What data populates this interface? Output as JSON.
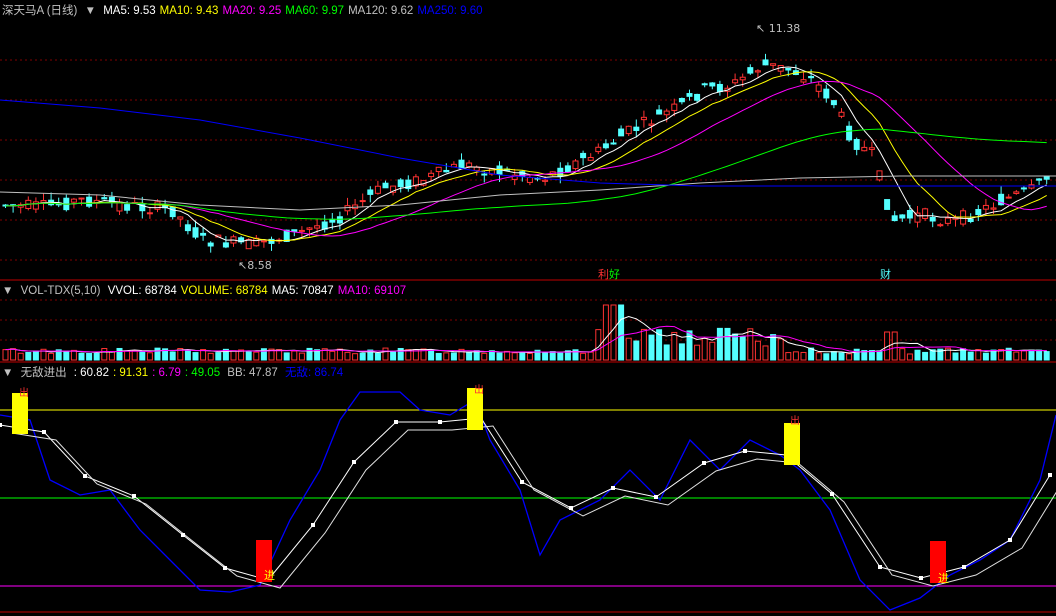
{
  "main": {
    "title": "深天马A (日线)",
    "ma": [
      {
        "label": "MA5:",
        "value": "9.53",
        "color": "#ffffff"
      },
      {
        "label": "MA10:",
        "value": "9.43",
        "color": "#ffff00"
      },
      {
        "label": "MA20:",
        "value": "9.25",
        "color": "#ff00ff"
      },
      {
        "label": "MA60:",
        "value": "9.97",
        "color": "#00ff00"
      },
      {
        "label": "MA120:",
        "value": "9.62",
        "color": "#c0c0c0"
      },
      {
        "label": "MA250:",
        "value": "9.60",
        "color": "#0000ff"
      }
    ],
    "high_label": "11.38",
    "low_label": "8.58",
    "markers": {
      "m1": "利",
      "m2": "好",
      "m3": "财"
    }
  },
  "volume": {
    "title": "VOL-TDX(5,10)",
    "items": [
      {
        "label": "VVOL: ",
        "value": "68784",
        "color": "#ffffff"
      },
      {
        "label": "VOLUME: ",
        "value": "68784",
        "color": "#ffff00"
      },
      {
        "label": "MA5: ",
        "value": "70847",
        "color": "#ffffff"
      },
      {
        "label": "MA10: ",
        "value": "69107",
        "color": "#ff00ff"
      }
    ]
  },
  "indicator": {
    "title": "无敌进出",
    "values": [
      {
        "value": ": 60.82",
        "color": "#ffffff"
      },
      {
        "value": ": 91.31",
        "color": "#ffff00"
      },
      {
        "value": ": 6.79",
        "color": "#ff00ff"
      },
      {
        "value": ": 49.05",
        "color": "#00ff00"
      },
      {
        "value": " BB: 47.87",
        "color": "#c0c0c0"
      },
      {
        "value": " 无敌: 86.74",
        "color": "#0000ff"
      }
    ],
    "sell_label": "出",
    "buy_label": "进"
  },
  "colors": {
    "up": "#ff3232",
    "down": "#54ffff",
    "grid": "#800000",
    "ma5": "#ffffff",
    "ma10": "#ffff00",
    "ma20": "#ff00ff",
    "ma60": "#00ff00",
    "ma120": "#c0c0c0",
    "ma250": "#0000ff"
  }
}
